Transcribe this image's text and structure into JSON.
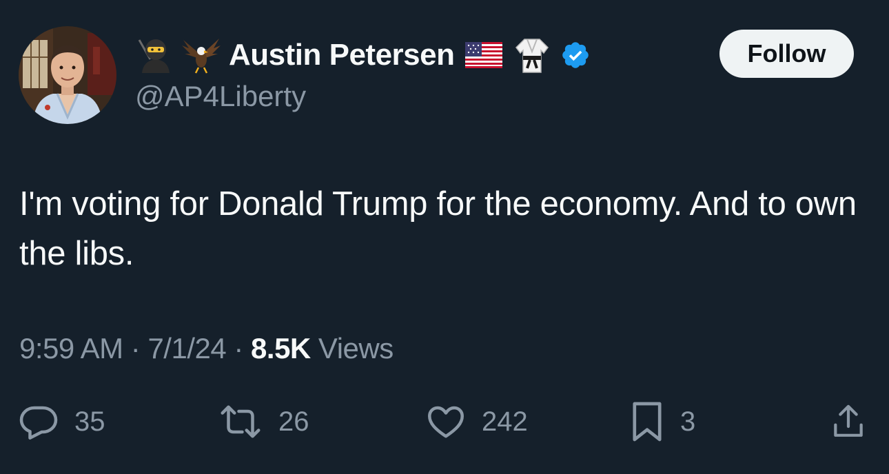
{
  "author": {
    "display_name": "Austin Petersen",
    "handle": "@AP4Liberty",
    "name_emojis": [
      "ninja-emoji",
      "eagle-emoji"
    ],
    "badge_emojis": [
      "us-flag-emoji",
      "martial-arts-uniform-emoji"
    ],
    "verified": true
  },
  "follow_label": "Follow",
  "tweet": {
    "text": "I'm voting for Donald Trump for the economy. And to own the libs."
  },
  "meta": {
    "time": "9:59 AM",
    "separator": " · ",
    "date": "7/1/24",
    "views_count": "8.5K",
    "views_label": " Views"
  },
  "actions": {
    "replies": "35",
    "reposts": "26",
    "likes": "242",
    "bookmarks": "3"
  },
  "colors": {
    "background": "#15202b",
    "text": "#f7f9f9",
    "secondary": "#8b98a5",
    "verified": "#1d9bf0",
    "follow_bg": "#eff3f4"
  }
}
